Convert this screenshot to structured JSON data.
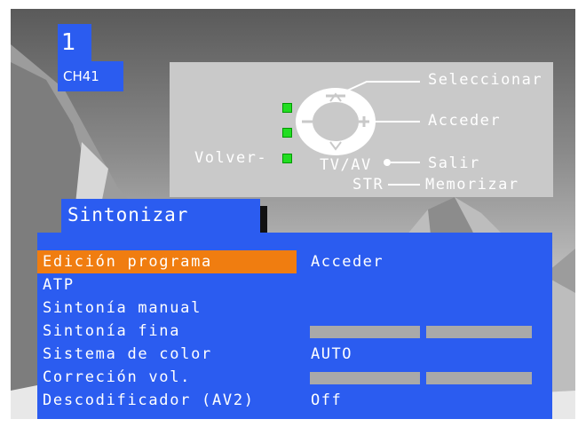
{
  "channel": {
    "number": "1",
    "name": "CH41"
  },
  "help": {
    "select_label": "Seleccionar",
    "access_label": "Acceder",
    "back_label": "Volver-",
    "exit_label": "Salir",
    "store_label": "Memorizar",
    "tvav_label": "TV/AV",
    "str_label": "STR",
    "led_color": "#22dd22"
  },
  "menu": {
    "title": "Sintonizar",
    "highlight_color": "#f07d10",
    "panel_color": "#2b5cf0",
    "items": [
      {
        "label": "Edición programa",
        "value": "Acceder",
        "active": true
      },
      {
        "label": "ATP",
        "value": ""
      },
      {
        "label": "Sintonía manual",
        "value": ""
      },
      {
        "label": "Sintonía fina",
        "value": ""
      },
      {
        "label": "Sistema de color",
        "value": "AUTO"
      },
      {
        "label": "Correción vol.",
        "value": ""
      },
      {
        "label": "Descodificador (AV2)",
        "value": "Off"
      }
    ]
  }
}
